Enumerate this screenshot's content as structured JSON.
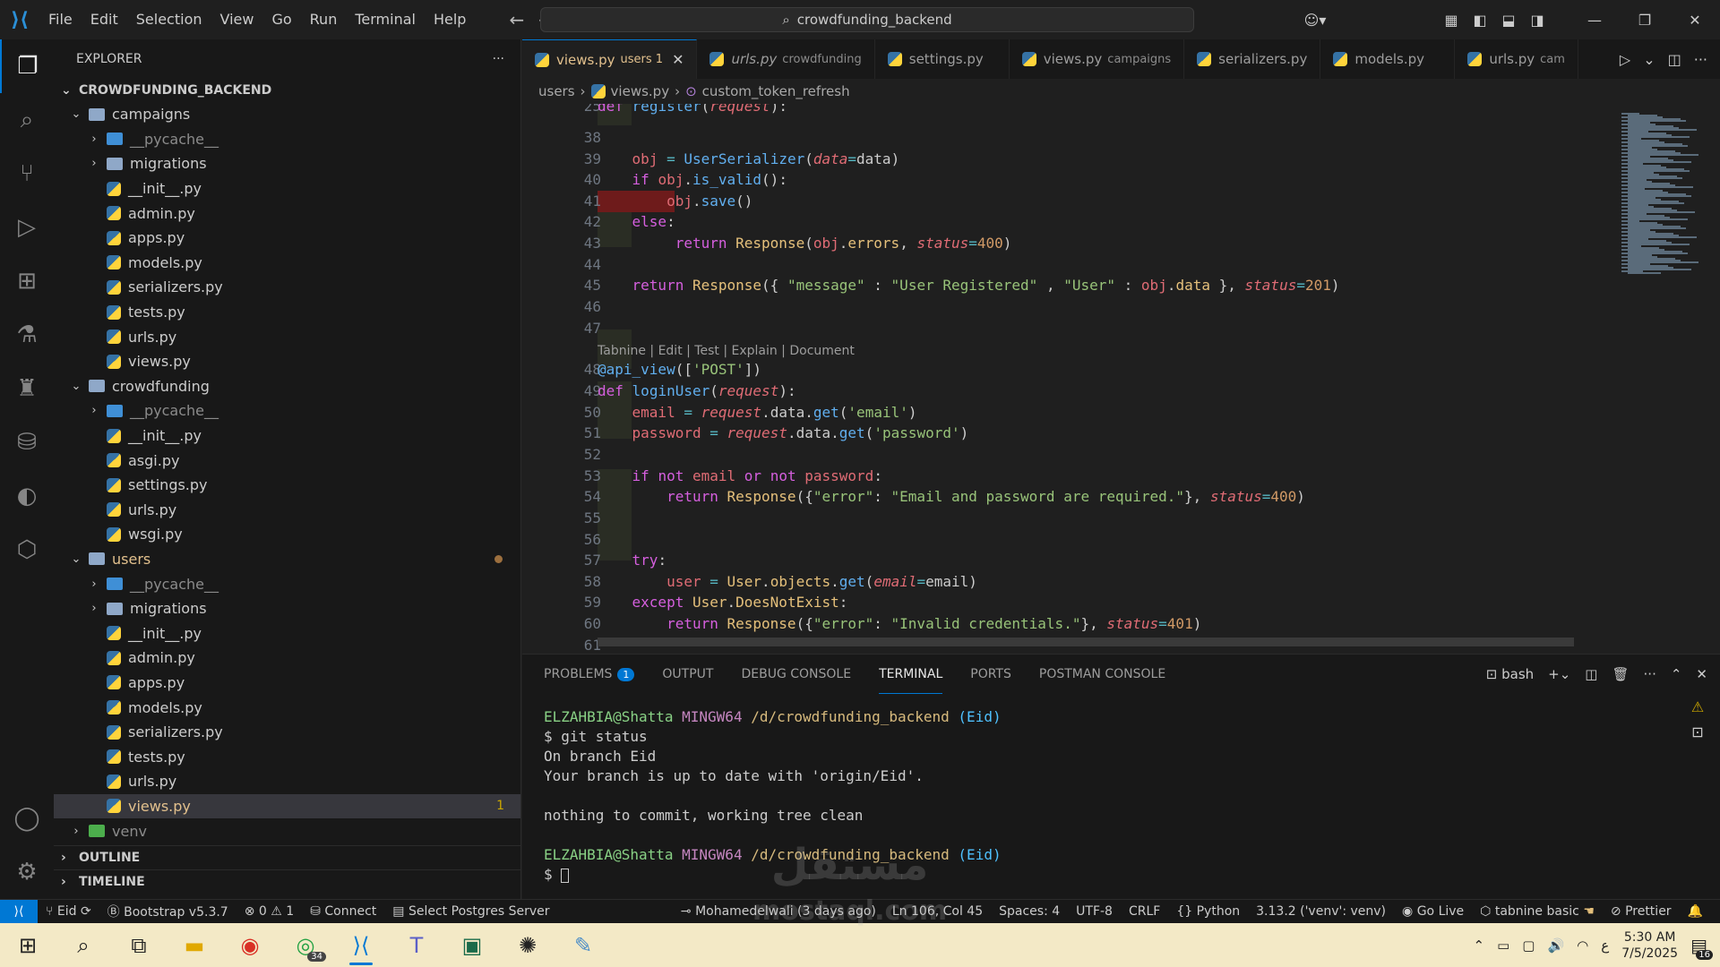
{
  "titlebar": {
    "menu": [
      "File",
      "Edit",
      "Selection",
      "View",
      "Go",
      "Run",
      "Terminal",
      "Help"
    ],
    "search_text": "crowdfunding_backend"
  },
  "sidebar": {
    "title": "EXPLORER",
    "root": "CROWDFUNDING_BACKEND",
    "tree": [
      {
        "label": "campaigns",
        "type": "folder-open",
        "depth": 1
      },
      {
        "label": "__pycache__",
        "type": "folder-blue",
        "depth": 2,
        "dim": true
      },
      {
        "label": "migrations",
        "type": "folder",
        "depth": 2
      },
      {
        "label": "__init__.py",
        "type": "py",
        "depth": 2
      },
      {
        "label": "admin.py",
        "type": "py",
        "depth": 2
      },
      {
        "label": "apps.py",
        "type": "py",
        "depth": 2
      },
      {
        "label": "models.py",
        "type": "py",
        "depth": 2
      },
      {
        "label": "serializers.py",
        "type": "py",
        "depth": 2
      },
      {
        "label": "tests.py",
        "type": "py",
        "depth": 2
      },
      {
        "label": "urls.py",
        "type": "py",
        "depth": 2
      },
      {
        "label": "views.py",
        "type": "py",
        "depth": 2
      },
      {
        "label": "crowdfunding",
        "type": "folder-open",
        "depth": 1
      },
      {
        "label": "__pycache__",
        "type": "folder-blue",
        "depth": 2,
        "dim": true
      },
      {
        "label": "__init__.py",
        "type": "py",
        "depth": 2
      },
      {
        "label": "asgi.py",
        "type": "py",
        "depth": 2
      },
      {
        "label": "settings.py",
        "type": "py",
        "depth": 2
      },
      {
        "label": "urls.py",
        "type": "py",
        "depth": 2
      },
      {
        "label": "wsgi.py",
        "type": "py",
        "depth": 2
      },
      {
        "label": "users",
        "type": "folder-open",
        "depth": 1,
        "yellow": true,
        "dot": true
      },
      {
        "label": "__pycache__",
        "type": "folder-blue",
        "depth": 2,
        "dim": true
      },
      {
        "label": "migrations",
        "type": "folder",
        "depth": 2
      },
      {
        "label": "__init__.py",
        "type": "py",
        "depth": 2
      },
      {
        "label": "admin.py",
        "type": "py",
        "depth": 2
      },
      {
        "label": "apps.py",
        "type": "py",
        "depth": 2
      },
      {
        "label": "models.py",
        "type": "py",
        "depth": 2
      },
      {
        "label": "serializers.py",
        "type": "py",
        "depth": 2
      },
      {
        "label": "tests.py",
        "type": "py",
        "depth": 2
      },
      {
        "label": "urls.py",
        "type": "py",
        "depth": 2
      },
      {
        "label": "views.py",
        "type": "py",
        "depth": 2,
        "yellow": true,
        "selected": true,
        "badge": "1"
      },
      {
        "label": "venv",
        "type": "folder-green",
        "depth": 1,
        "dim": true
      }
    ],
    "sections": [
      "OUTLINE",
      "TIMELINE"
    ]
  },
  "tabs": [
    {
      "name": "views.py",
      "desc": "users 1",
      "active": true
    },
    {
      "name": "urls.py",
      "desc": "crowdfunding",
      "italic": true
    },
    {
      "name": "settings.py",
      "desc": ""
    },
    {
      "name": "views.py",
      "desc": "campaigns"
    },
    {
      "name": "serializers.py",
      "desc": ""
    },
    {
      "name": "models.py",
      "desc": ""
    },
    {
      "name": "urls.py",
      "desc": "cam"
    }
  ],
  "breadcrumb": {
    "folder": "users",
    "file": "views.py",
    "symbol": "custom_token_refresh"
  },
  "editor": {
    "codelens": "Tabnine | Edit | Test | Explain | Document"
  },
  "panel": {
    "tabs": [
      "PROBLEMS",
      "OUTPUT",
      "DEBUG CONSOLE",
      "TERMINAL",
      "PORTS",
      "POSTMAN CONSOLE"
    ],
    "problems_count": "1",
    "shell": "bash",
    "terminal": {
      "user_host": "ELZAHBIA@Shatta",
      "env": "MINGW64",
      "path": "/d/crowdfunding_backend",
      "branch": "(Eid)",
      "command": "$ git status",
      "out1": "On branch Eid",
      "out2": "Your branch is up to date with 'origin/Eid'.",
      "out3": "nothing to commit, working tree clean",
      "prompt": "$"
    }
  },
  "statusbar": {
    "branch": "Eid",
    "bootstrap": "Bootstrap v5.3.7",
    "errors": "0",
    "warnings": "1",
    "connect": "Connect",
    "postgres": "Select Postgres Server",
    "blame": "Mohamedelwali (3 days ago)",
    "position": "Ln 106, Col 45",
    "spaces": "Spaces: 4",
    "encoding": "UTF-8",
    "eol": "CRLF",
    "language": "Python",
    "interpreter": "3.13.2 ('venv': venv)",
    "golive": "Go Live",
    "tabnine": "tabnine basic",
    "prettier": "Prettier"
  },
  "taskbar": {
    "whatsapp_badge": "34",
    "time": "5:30 AM",
    "date": "7/5/2025",
    "lang": "ع",
    "notif_count": "16"
  },
  "watermark": {
    "line1": "مستقل",
    "line2": "mostaql.com"
  }
}
